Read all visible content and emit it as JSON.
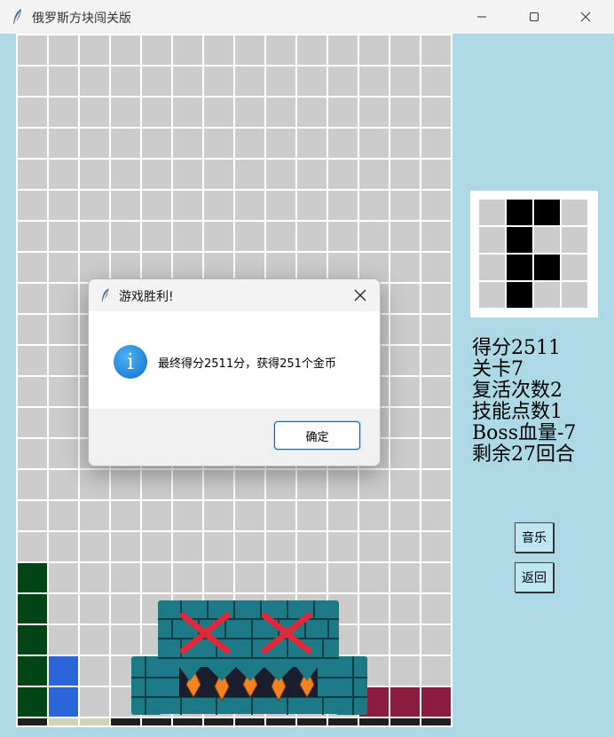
{
  "window": {
    "title": "俄罗斯方块闯关版",
    "icon": "feather-icon",
    "controls": [
      "minimize-icon",
      "maximize-icon",
      "close-icon"
    ]
  },
  "board": {
    "cols": 14,
    "rows": 22,
    "colors": {
      "empty": "#cccccc",
      "green": "#014415",
      "blue": "#2b66d9",
      "beige": "#d2d2b4",
      "maroon": "#8b1d40",
      "dark": "#1f1f1f",
      "grid_line": "#ffffff"
    },
    "filled_cells": [
      {
        "row": 17,
        "col": 0,
        "color": "green"
      },
      {
        "row": 18,
        "col": 0,
        "color": "green"
      },
      {
        "row": 19,
        "col": 0,
        "color": "green"
      },
      {
        "row": 20,
        "col": 0,
        "color": "green"
      },
      {
        "row": 21,
        "col": 0,
        "color": "green"
      },
      {
        "row": 20,
        "col": 1,
        "color": "blue"
      },
      {
        "row": 21,
        "col": 1,
        "color": "blue"
      },
      {
        "row": 21,
        "col": 11,
        "color": "maroon"
      },
      {
        "row": 21,
        "col": 12,
        "color": "maroon"
      },
      {
        "row": 21,
        "col": 13,
        "color": "maroon"
      }
    ],
    "bottom_strip": [
      "dark",
      "beige",
      "beige",
      "dark",
      "dark",
      "dark",
      "dark",
      "dark",
      "dark",
      "dark",
      "dark",
      "dark",
      "dark",
      "dark"
    ],
    "boss": {
      "icon": "boss-monster-icon",
      "colors": {
        "stone": "#1c7a86",
        "eye_x": "#e0283a",
        "teeth": "#f58220"
      }
    }
  },
  "preview": {
    "cols": 4,
    "rows": 4,
    "filled": [
      [
        0,
        1
      ],
      [
        0,
        2
      ],
      [
        1,
        1
      ],
      [
        2,
        1
      ],
      [
        2,
        2
      ],
      [
        3,
        1
      ]
    ]
  },
  "stats": {
    "score": "得分2511",
    "level": "关卡7",
    "revives": "复活次数2",
    "skill_points": "技能点数1",
    "boss_hp": "Boss血量-7",
    "turns_left": "剩余27回合"
  },
  "buttons": {
    "music": "音乐",
    "back": "返回"
  },
  "dialog": {
    "title": "游戏胜利!",
    "message": "最终得分2511分，获得251个金币",
    "ok": "确定",
    "icon": "info-icon"
  }
}
